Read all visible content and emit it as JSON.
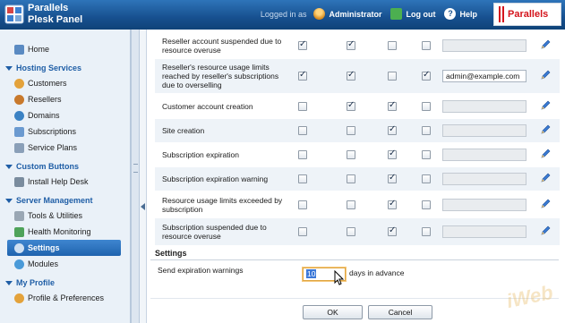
{
  "header": {
    "product_line1": "Parallels",
    "product_line2": "Plesk Panel",
    "logged_in_as": "Logged in as",
    "user": "Administrator",
    "logout": "Log out",
    "help": "Help",
    "brand": "Parallels",
    "logo_icon": "plesk-grid-icon",
    "user_icon": "user-icon",
    "logout_icon": "logout-icon",
    "help_icon": "help-icon"
  },
  "sidebar": {
    "home": "Home",
    "sections": [
      {
        "title": "Hosting Services",
        "items": [
          "Customers",
          "Resellers",
          "Domains",
          "Subscriptions",
          "Service Plans"
        ]
      },
      {
        "title": "Custom Buttons",
        "items": [
          "Install Help Desk"
        ]
      },
      {
        "title": "Server Management",
        "items": [
          "Tools & Utilities",
          "Health Monitoring",
          "Settings",
          "Modules"
        ]
      },
      {
        "title": "My Profile",
        "items": [
          "Profile & Preferences"
        ]
      }
    ],
    "active_item": "Settings"
  },
  "notifications": {
    "rows": [
      {
        "label": "Reseller account suspended due to resource overuse",
        "checks": [
          true,
          true,
          false,
          false
        ],
        "email": ""
      },
      {
        "label": "Reseller's resource usage limits reached by reseller's subscriptions due to overselling",
        "checks": [
          true,
          true,
          false,
          true
        ],
        "email": "admin@example.com"
      },
      {
        "label": "Customer account creation",
        "checks": [
          false,
          true,
          true,
          false
        ],
        "email": ""
      },
      {
        "label": "Site creation",
        "checks": [
          false,
          false,
          true,
          false
        ],
        "email": ""
      },
      {
        "label": "Subscription expiration",
        "checks": [
          false,
          false,
          true,
          false
        ],
        "email": ""
      },
      {
        "label": "Subscription expiration warning",
        "checks": [
          false,
          false,
          true,
          false
        ],
        "email": ""
      },
      {
        "label": "Resource usage limits exceeded by subscription",
        "checks": [
          false,
          false,
          true,
          false
        ],
        "email": ""
      },
      {
        "label": "Subscription suspended due to resource overuse",
        "checks": [
          false,
          false,
          true,
          false
        ],
        "email": ""
      }
    ]
  },
  "settings": {
    "heading": "Settings",
    "expiration_label": "Send expiration warnings",
    "days_value": "10",
    "days_suffix": "days in advance"
  },
  "buttons": {
    "ok": "OK",
    "cancel": "Cancel"
  },
  "colors": {
    "header_blue": "#17508f",
    "accent_blue": "#1f5ea6",
    "brand_red": "#d4141c"
  },
  "watermark": "iWeb"
}
